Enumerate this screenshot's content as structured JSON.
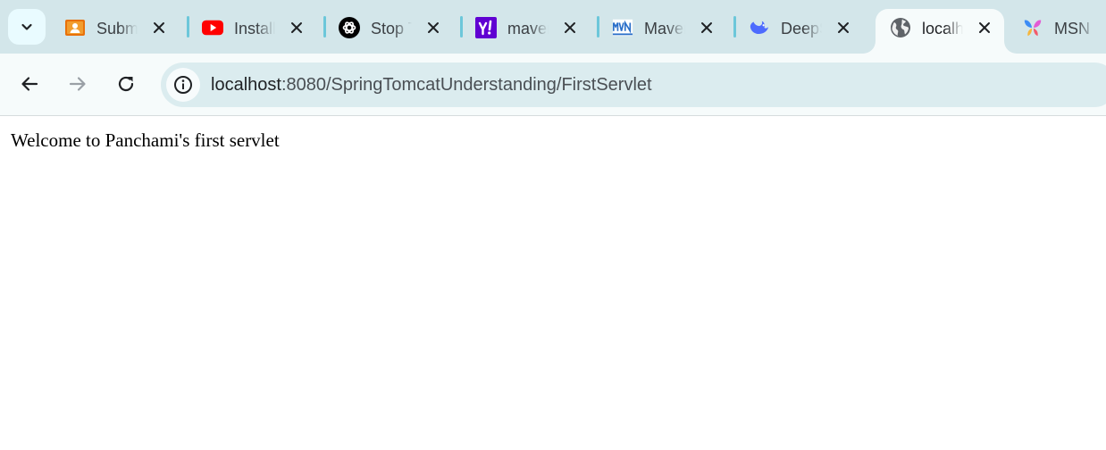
{
  "tabs": [
    {
      "title": "Submit",
      "icon": "classroom-icon"
    },
    {
      "title": "Install",
      "icon": "youtube-icon"
    },
    {
      "title": "Stop T",
      "icon": "chatgpt-icon"
    },
    {
      "title": "maven",
      "icon": "yahoo-icon"
    },
    {
      "title": "Maven",
      "icon": "mvn-icon"
    },
    {
      "title": "DeepS",
      "icon": "deepseek-icon"
    },
    {
      "title": "localh",
      "icon": "globe-icon",
      "active": true
    },
    {
      "title": "MSN",
      "icon": "msn-icon"
    }
  ],
  "address_bar": {
    "host": "localhost",
    "path": ":8080/SpringTomcatUnderstanding/FirstServlet"
  },
  "page": {
    "body_text": "Welcome to Panchami's first servlet"
  },
  "colors": {
    "tabstrip_bg": "#d3e6ea",
    "toolbar_bg": "#f6fbfb",
    "omnibox_bg": "#dbecef",
    "tab_separator": "#6cc7da"
  }
}
